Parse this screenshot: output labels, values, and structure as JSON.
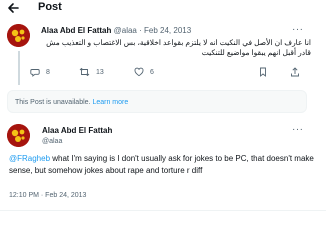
{
  "header": {
    "title": "Post"
  },
  "tweet1": {
    "name": "Alaa Abd El Fattah",
    "handle": "@alaa",
    "date": "Feb 24, 2013",
    "dot": "·",
    "text": "انا عارف ان الأصل في النكيت انه لا يلتزم بقواعد اخلاقية، بس الاغتصاب و التعذيب مش قادر أقبل انهم يبقوا مواضيع للتنكيت",
    "replies": "8",
    "reposts": "13",
    "likes": "6"
  },
  "unavailable": {
    "text": "This Post is unavailable.",
    "link": "Learn more"
  },
  "tweet2": {
    "name": "Alaa Abd El Fattah",
    "handle": "@alaa",
    "mention": "@FRagheb",
    "text": " what I'm saying is I don't usually ask for jokes to be PC, that doesn't make sense, but somehow jokes about rape and torture r diff",
    "time": "12:10 PM · Feb 24, 2013"
  },
  "icons": [
    "back-arrow-icon",
    "reply-icon",
    "repost-icon",
    "like-icon",
    "bookmark-icon",
    "share-icon",
    "more-icon"
  ],
  "colors": {
    "accent": "#1d9bf0",
    "muted": "#536471",
    "avatar": "#a6140e"
  }
}
